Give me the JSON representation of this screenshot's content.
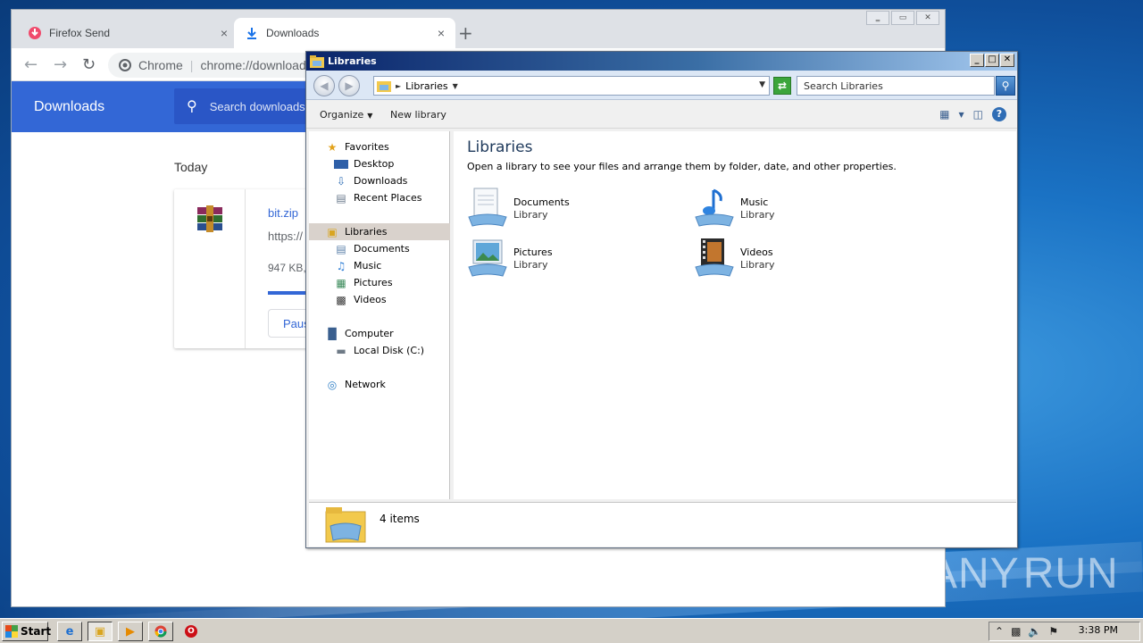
{
  "browser": {
    "tabs": [
      {
        "label": "Firefox Send",
        "close": "×"
      },
      {
        "label": "Downloads",
        "close": "×"
      }
    ],
    "new_tab": "+",
    "window_buttons": [
      "‗",
      "▭",
      "✕"
    ],
    "omnibox": {
      "site": "Chrome",
      "url": "chrome://downloads"
    },
    "downloads_page": {
      "title": "Downloads",
      "search_placeholder": "Search downloads",
      "section": "Today",
      "item": {
        "filename": "bit.zip",
        "url": "https://",
        "status": "947 KB,",
        "progress": 0.4,
        "pause_label": "Pause"
      }
    }
  },
  "explorer": {
    "title": "Libraries",
    "window_buttons": [
      "_",
      "□",
      "✕"
    ],
    "address": {
      "path": "Libraries"
    },
    "search_placeholder": "Search Libraries",
    "commands": {
      "organize": "Organize",
      "new_library": "New library"
    },
    "nav": {
      "favorites": "Favorites",
      "desktop": "Desktop",
      "downloads": "Downloads",
      "recent": "Recent Places",
      "libraries": "Libraries",
      "documents": "Documents",
      "music": "Music",
      "pictures": "Pictures",
      "videos": "Videos",
      "computer": "Computer",
      "local_disk": "Local Disk (C:)",
      "network": "Network"
    },
    "content": {
      "heading": "Libraries",
      "subtitle": "Open a library to see your files and arrange them by folder, date, and other properties.",
      "tiles": [
        {
          "name": "Documents",
          "kind": "Library"
        },
        {
          "name": "Music",
          "kind": "Library"
        },
        {
          "name": "Pictures",
          "kind": "Library"
        },
        {
          "name": "Videos",
          "kind": "Library"
        }
      ]
    },
    "status": {
      "count": "4 items"
    }
  },
  "taskbar": {
    "start_label": "Start",
    "clock": "3:38 PM",
    "apps": [
      "ie-icon",
      "explorer-icon",
      "media-player-icon",
      "chrome-icon",
      "opera-icon"
    ]
  },
  "watermark": {
    "text_left": "ANY",
    "text_right": "RUN"
  },
  "colors": {
    "chrome_header": "#3367d6",
    "link": "#3367d6",
    "explorer_title_gradient_start": "#0a246a",
    "selection": "#d9d2cc"
  }
}
